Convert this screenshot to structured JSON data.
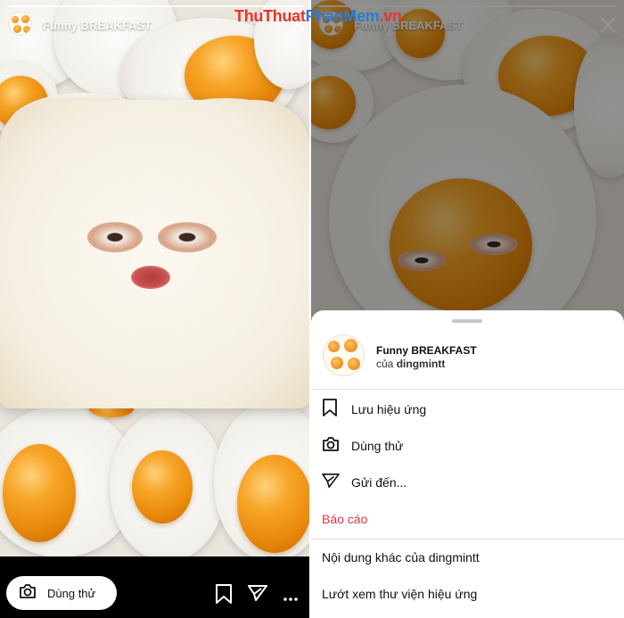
{
  "watermark": {
    "part1": "ThuThuat",
    "part2": "PhanMem",
    "part3": ".vn"
  },
  "left": {
    "effect_name": "Funny BREAKFAST",
    "try_button_label": "Dùng thử",
    "icons": [
      "camera-icon",
      "bookmark-icon",
      "send-icon",
      "more-icon",
      "close-icon"
    ]
  },
  "right": {
    "header_effect_name": "Funny BREAKFAST",
    "sheet": {
      "effect_name": "Funny BREAKFAST",
      "by_prefix": "của",
      "creator": "dingmintt",
      "items": [
        {
          "label": "Lưu hiệu ứng",
          "icon": "bookmark-icon"
        },
        {
          "label": "Dùng thử",
          "icon": "camera-icon"
        },
        {
          "label": "Gửi đến...",
          "icon": "send-icon"
        },
        {
          "label": "Báo cáo",
          "icon": "",
          "color": "#e0344a"
        },
        {
          "label": "Nội dung khác của dingmintt",
          "icon": ""
        },
        {
          "label": "Lướt xem thư viện hiệu ứng",
          "icon": ""
        }
      ]
    }
  },
  "colors": {
    "report_red": "#e0344a",
    "sheet_bg": "#ffffff",
    "yolk": "#f7a528"
  }
}
